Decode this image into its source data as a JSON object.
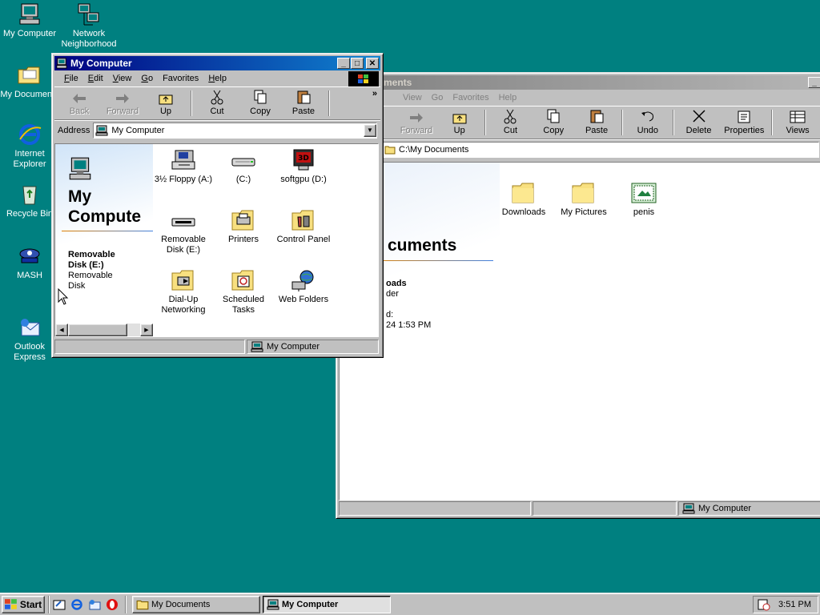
{
  "desktop": {
    "icons": [
      {
        "label": "My Computer",
        "icon": "my-computer-icon"
      },
      {
        "label": "Network Neighborhood",
        "icon": "network-icon"
      },
      {
        "label": "My Documents",
        "icon": "folder-icon"
      },
      {
        "label": "Internet Explorer",
        "icon": "ie-icon"
      },
      {
        "label": "Recycle Bin",
        "icon": "recycle-bin-icon"
      },
      {
        "label": "MASH",
        "icon": "mash-icon"
      },
      {
        "label": "Outlook Express",
        "icon": "outlook-icon"
      }
    ]
  },
  "mydocs_window": {
    "title": "My Documents",
    "menu": [
      "View",
      "Go",
      "Favorites",
      "Help"
    ],
    "toolbar": [
      "Forward",
      "Up",
      "Cut",
      "Copy",
      "Paste",
      "Undo",
      "Delete",
      "Properties",
      "Views"
    ],
    "address": "C:\\My Documents",
    "items": [
      "Downloads",
      "My Pictures",
      "penis"
    ],
    "heading": "cuments",
    "info_name": "oads",
    "info_type": "der",
    "info_modified_label": "d:",
    "info_date": "24 1:53 PM",
    "status": "My Computer"
  },
  "mycomp_window": {
    "title": "My Computer",
    "menu": [
      {
        "label": "File",
        "u": "F",
        "rest": "ile"
      },
      {
        "label": "Edit",
        "u": "E",
        "rest": "dit"
      },
      {
        "label": "View",
        "u": "V",
        "rest": "iew"
      },
      {
        "label": "Go",
        "u": "G",
        "rest": "o"
      },
      {
        "label": "Favorites",
        "u": "",
        "rest": "Favorites"
      },
      {
        "label": "Help",
        "u": "H",
        "rest": "elp"
      }
    ],
    "toolbar": [
      "Back",
      "Forward",
      "Up",
      "Cut",
      "Copy",
      "Paste"
    ],
    "address_label": "Address",
    "address": "My Computer",
    "side_title_1": "My",
    "side_title_2": "Compute",
    "selected_name_1": "Removable",
    "selected_name_2": "Disk (E:)",
    "selected_type_1": "Removable",
    "selected_type_2": "Disk",
    "items": [
      {
        "label": "3½ Floppy (A:)",
        "icon": "floppy-drive-icon"
      },
      {
        "label": "(C:)",
        "icon": "hard-drive-icon"
      },
      {
        "label": "softgpu (D:)",
        "icon": "cd-drive-icon"
      },
      {
        "label": "Removable Disk (E:)",
        "icon": "removable-drive-icon"
      },
      {
        "label": "Printers",
        "icon": "printers-folder-icon"
      },
      {
        "label": "Control Panel",
        "icon": "control-panel-icon"
      },
      {
        "label": "Dial-Up Networking",
        "icon": "dialup-icon"
      },
      {
        "label": "Scheduled Tasks",
        "icon": "scheduled-tasks-icon"
      },
      {
        "label": "Web Folders",
        "icon": "web-folders-icon"
      }
    ],
    "status": "My Computer"
  },
  "taskbar": {
    "start": "Start",
    "tasks": [
      "My Documents",
      "My Computer"
    ],
    "clock": "3:51 PM"
  },
  "colors": {
    "desktop": "#008080",
    "title_active": "#000080",
    "title_inactive": "#808080"
  }
}
